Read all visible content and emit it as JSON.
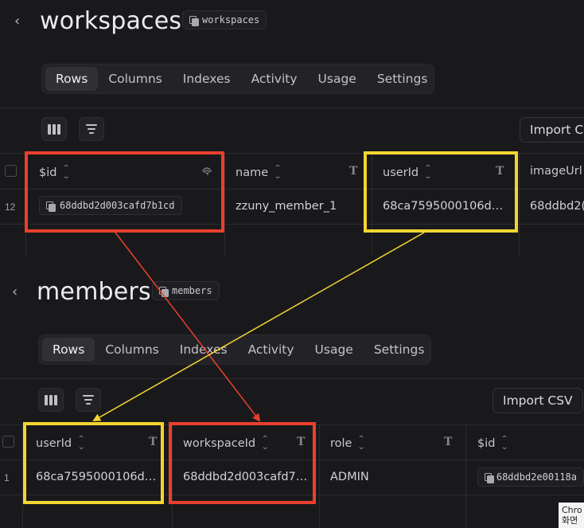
{
  "workspaces": {
    "back_icon": "chevron-left-icon",
    "title": "workspaces",
    "chip_label": "workspaces",
    "tabs": [
      {
        "label": "Rows",
        "active": true
      },
      {
        "label": "Columns",
        "active": false
      },
      {
        "label": "Indexes",
        "active": false
      },
      {
        "label": "Activity",
        "active": false
      },
      {
        "label": "Usage",
        "active": false
      },
      {
        "label": "Settings",
        "active": false
      }
    ],
    "import_label": "Import CS",
    "columns": [
      {
        "label": "$id",
        "type_icon": "fingerprint-icon"
      },
      {
        "label": "name",
        "type_icon": "text-type-icon"
      },
      {
        "label": "userId",
        "type_icon": "text-type-icon"
      },
      {
        "label": "imageUrl",
        "type_icon": ""
      }
    ],
    "rows": [
      {
        "row_number": "12",
        "id": "68ddbd2d003cafd7b1cd",
        "name": "zzuny_member_1",
        "userId": "68ca7595000106d…",
        "imageUrl": "68ddbd2("
      }
    ]
  },
  "members": {
    "back_icon": "chevron-left-icon",
    "title": "members",
    "chip_label": "members",
    "tabs": [
      {
        "label": "Rows",
        "active": true
      },
      {
        "label": "Columns",
        "active": false
      },
      {
        "label": "Indexes",
        "active": false
      },
      {
        "label": "Activity",
        "active": false
      },
      {
        "label": "Usage",
        "active": false
      },
      {
        "label": "Settings",
        "active": false
      }
    ],
    "import_label": "Import CSV",
    "columns": [
      {
        "label": "userId",
        "type_icon": "text-type-icon"
      },
      {
        "label": "workspaceId",
        "type_icon": "text-type-icon"
      },
      {
        "label": "role",
        "type_icon": "text-type-icon"
      },
      {
        "label": "$id",
        "type_icon": ""
      }
    ],
    "rows": [
      {
        "row_number": "1",
        "userId": "68ca7595000106d…",
        "workspaceId": "68ddbd2d003cafd7…",
        "role": "ADMIN",
        "id": "68ddbd2e00118a"
      }
    ]
  },
  "tooltip": {
    "line1": "Chro",
    "line2": "화면"
  },
  "colors": {
    "annotation_red": "#e9402c",
    "annotation_yellow": "#f3d530",
    "background": "#19191c"
  }
}
